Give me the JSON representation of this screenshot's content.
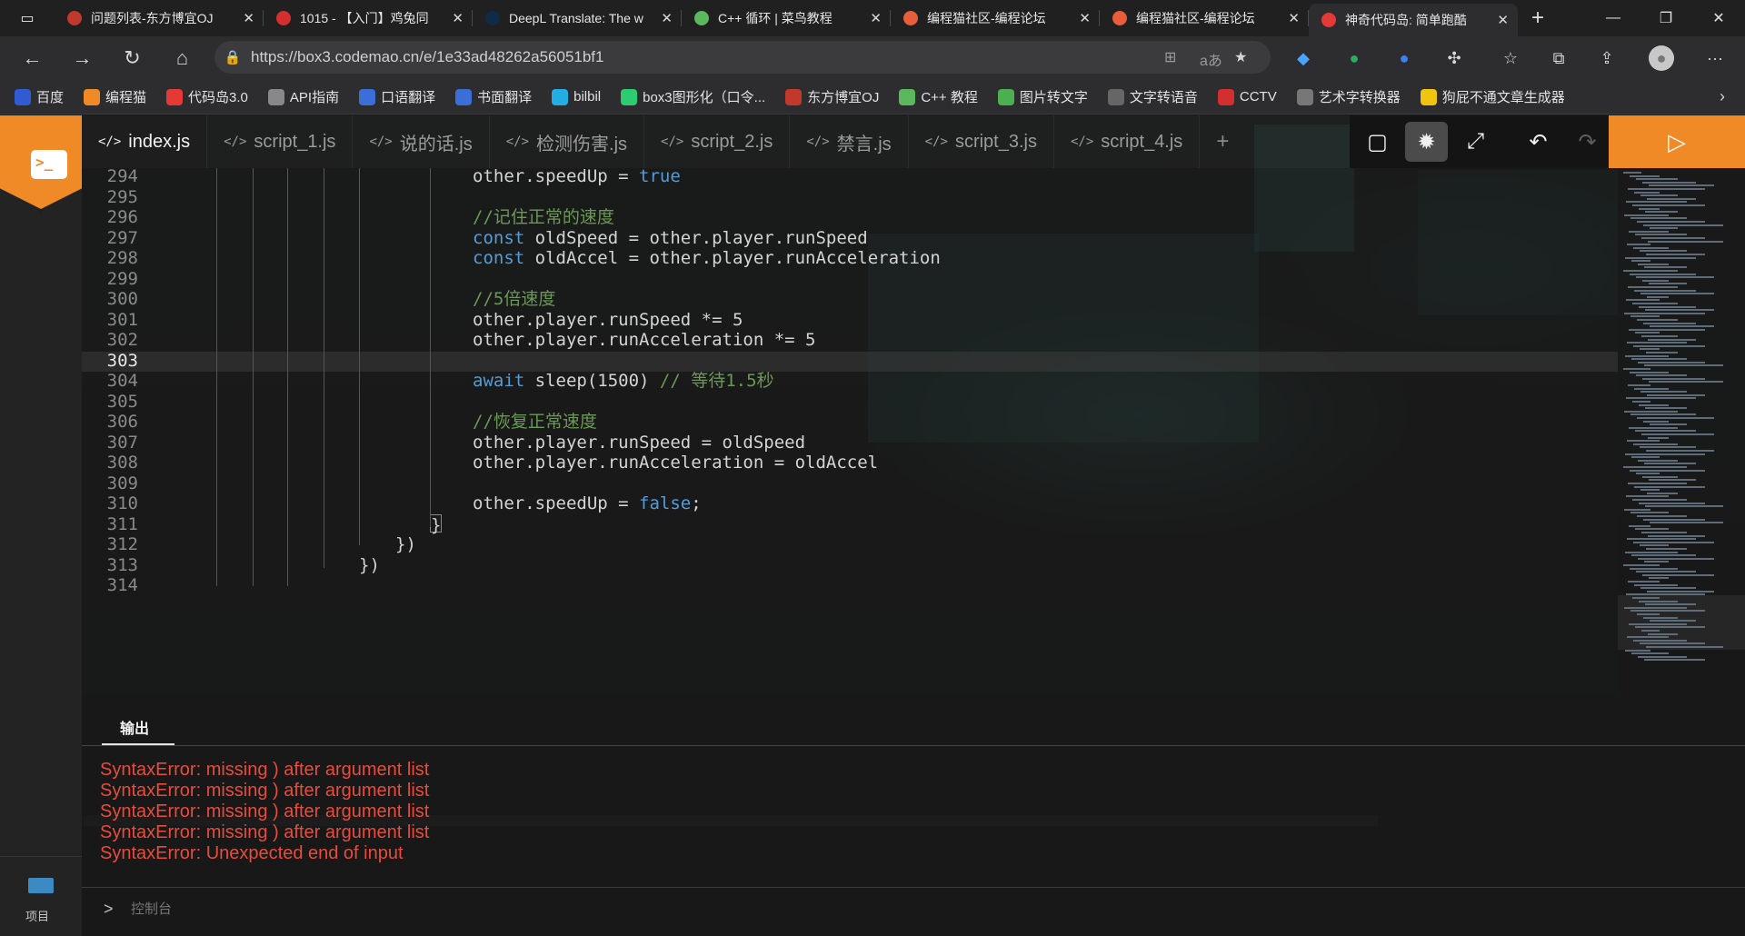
{
  "browser": {
    "tabs": [
      {
        "title": "问题列表-东方博宜OJ",
        "icon_color": "#c0392b"
      },
      {
        "title": "1015 - 【入门】鸡兔同",
        "icon_color": "#d32f2f"
      },
      {
        "title": "DeepL Translate: The w",
        "icon_color": "#0f2b46"
      },
      {
        "title": "C++ 循环 | 菜鸟教程",
        "icon_color": "#5cb85c"
      },
      {
        "title": "编程猫社区-编程论坛",
        "icon_color": "#e85d3a"
      },
      {
        "title": "编程猫社区-编程论坛",
        "icon_color": "#e85d3a"
      },
      {
        "title": "神奇代码岛: 简单跑酷",
        "icon_color": "#e53935"
      }
    ],
    "url": "https://box3.codemao.cn/e/1e33ad48262a56051bf1",
    "bookmarks": [
      {
        "label": "百度",
        "color": "#2f5bd3"
      },
      {
        "label": "编程猫",
        "color": "#f08a26"
      },
      {
        "label": "代码岛3.0",
        "color": "#e53935"
      },
      {
        "label": "API指南",
        "color": "#888888"
      },
      {
        "label": "口语翻译",
        "color": "#3a6fd8"
      },
      {
        "label": "书面翻译",
        "color": "#3a6fd8"
      },
      {
        "label": "bilbil",
        "color": "#23ade5"
      },
      {
        "label": "box3图形化（口令...",
        "color": "#2ecc71"
      },
      {
        "label": "东方博宜OJ",
        "color": "#c0392b"
      },
      {
        "label": "C++ 教程",
        "color": "#5cb85c"
      },
      {
        "label": "图片转文字",
        "color": "#4caf50"
      },
      {
        "label": "文字转语音",
        "color": "#666666"
      },
      {
        "label": "CCTV",
        "color": "#d32f2f"
      },
      {
        "label": "艺术字转换器",
        "color": "#777777"
      },
      {
        "label": "狗屁不通文章生成器",
        "color": "#f1c40f"
      }
    ]
  },
  "editor": {
    "file_tabs": [
      {
        "label": "index.js",
        "active": true
      },
      {
        "label": "script_1.js",
        "active": false
      },
      {
        "label": "说的话.js",
        "active": false
      },
      {
        "label": "检测伤害.js",
        "active": false
      },
      {
        "label": "script_2.js",
        "active": false
      },
      {
        "label": "禁言.js",
        "active": false
      },
      {
        "label": "script_3.js",
        "active": false
      },
      {
        "label": "script_4.js",
        "active": false
      }
    ],
    "add_tab": "+",
    "current_line": 303,
    "lines": [
      {
        "num": "294",
        "code": "other.speedUp = true"
      },
      {
        "num": "295",
        "code": ""
      },
      {
        "num": "296",
        "code": "//记住正常的速度"
      },
      {
        "num": "297",
        "code": "const oldSpeed = other.player.runSpeed"
      },
      {
        "num": "298",
        "code": "const oldAccel = other.player.runAcceleration"
      },
      {
        "num": "299",
        "code": ""
      },
      {
        "num": "300",
        "code": "//5倍速度"
      },
      {
        "num": "301",
        "code": "other.player.runSpeed *= 5"
      },
      {
        "num": "302",
        "code": "other.player.runAcceleration *= 5"
      },
      {
        "num": "303",
        "code": ""
      },
      {
        "num": "304",
        "code": "await sleep(1500) // 等待1.5秒"
      },
      {
        "num": "305",
        "code": ""
      },
      {
        "num": "306",
        "code": "//恢复正常速度"
      },
      {
        "num": "307",
        "code": "other.player.runSpeed = oldSpeed"
      },
      {
        "num": "308",
        "code": "other.player.runAcceleration = oldAccel"
      },
      {
        "num": "309",
        "code": ""
      },
      {
        "num": "310",
        "code": "other.speedUp = false;"
      },
      {
        "num": "311",
        "code": "}"
      },
      {
        "num": "312",
        "code": "})"
      },
      {
        "num": "313",
        "code": "})"
      },
      {
        "num": "314",
        "code": ""
      }
    ]
  },
  "sidebar": {
    "project_label": "项目"
  },
  "output": {
    "tab_label": "输出",
    "errors": [
      "SyntaxError: missing ) after argument list",
      "SyntaxError: missing ) after argument list",
      "SyntaxError: missing ) after argument list",
      "SyntaxError: missing ) after argument list",
      "SyntaxError: Unexpected end of input"
    ],
    "console_placeholder": "控制台",
    "console_prompt": ">"
  },
  "colors": {
    "accent": "#f08a26",
    "error": "#e74c3c",
    "keyword": "#569cd6",
    "comment": "#6a9955"
  }
}
